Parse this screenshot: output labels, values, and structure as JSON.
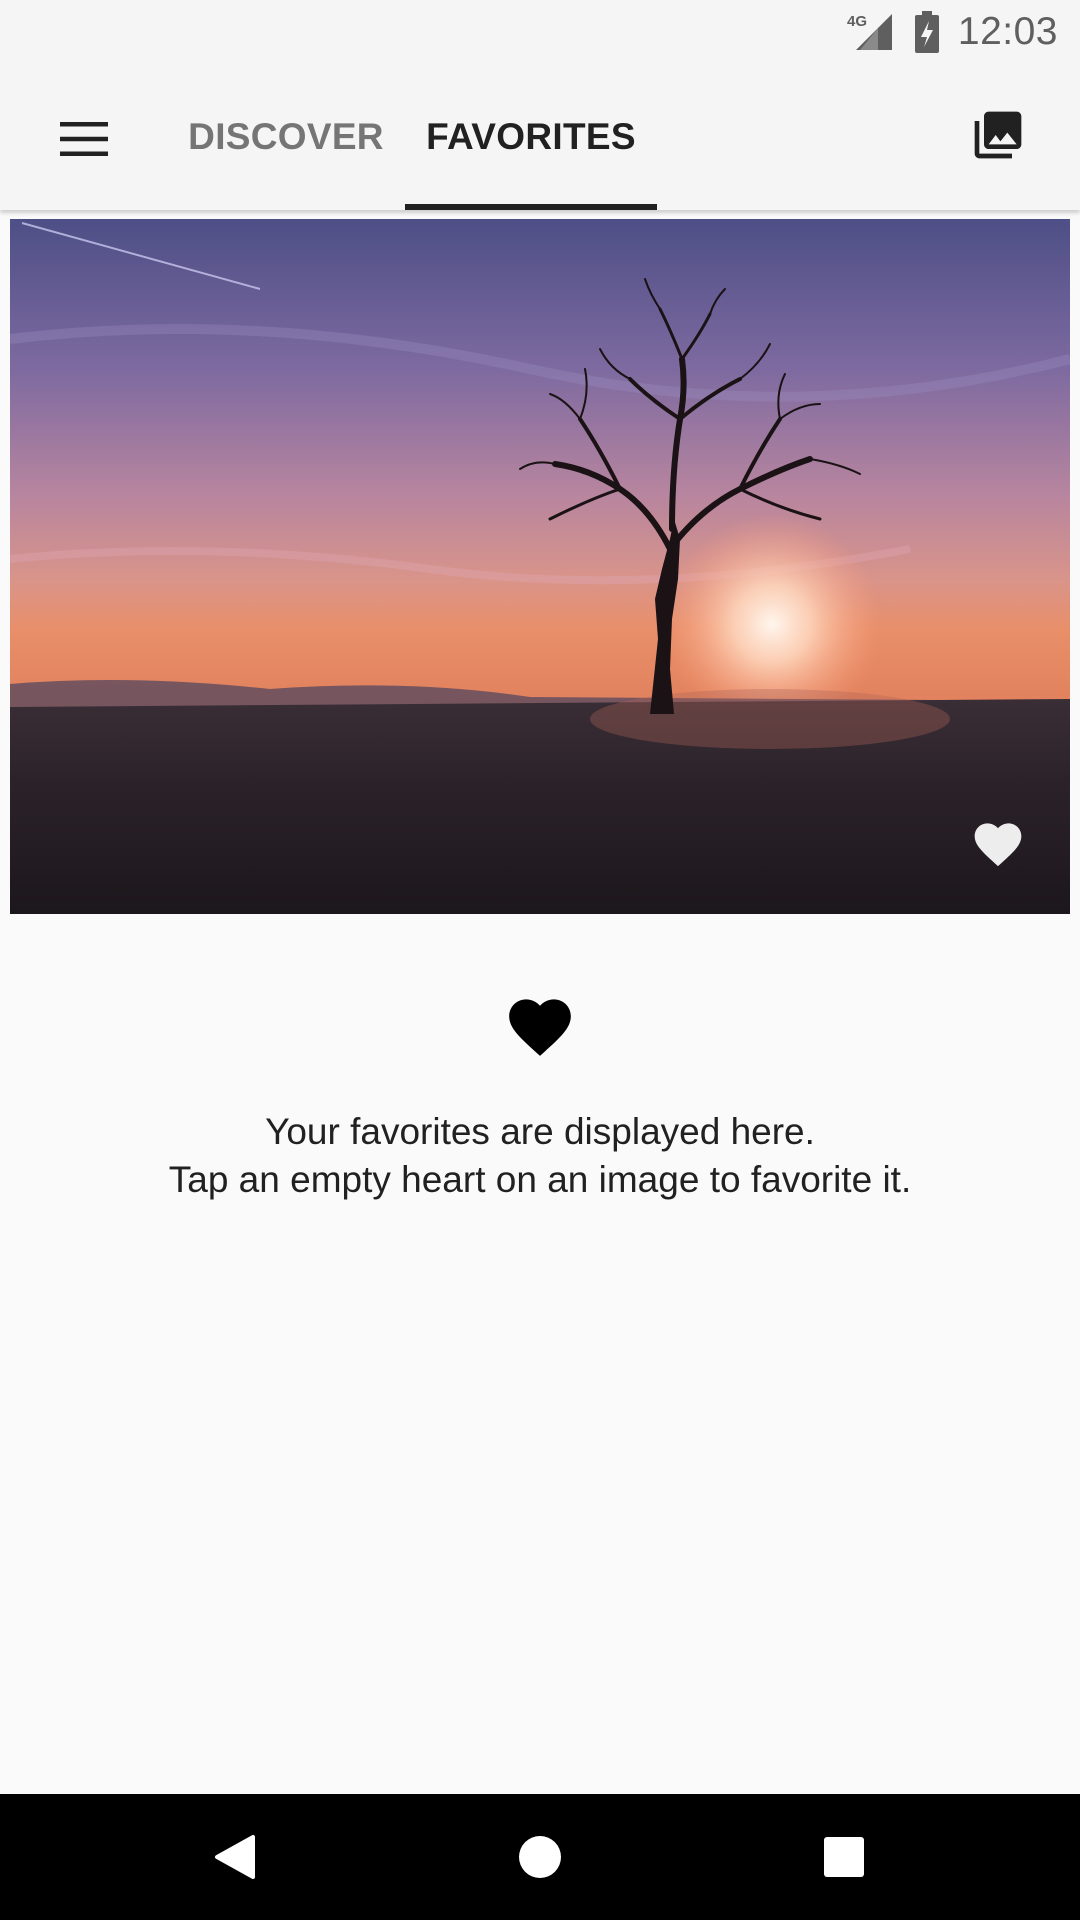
{
  "status_bar": {
    "network_label": "4G",
    "time": "12:03"
  },
  "tabs": [
    {
      "label": "DISCOVER",
      "selected": false
    },
    {
      "label": "FAVORITES",
      "selected": true
    }
  ],
  "icons": {
    "menu": "hamburger-menu-icon",
    "gallery": "photo-library-icon",
    "photo_favorite": "heart-icon",
    "empty_state": "heart-icon",
    "nav_back": "back-triangle-icon",
    "nav_home": "home-circle-icon",
    "nav_recents": "recents-square-icon"
  },
  "favorites": {
    "items": [
      {
        "subject": "tree-at-sunset-photo",
        "favorited": true
      }
    ]
  },
  "empty_state": {
    "line1": "Your favorites are displayed here.",
    "line2": "Tap an empty heart on an image to favorite it."
  },
  "colors": {
    "app_bar_bg": "#f5f5f5",
    "text_primary": "#212121",
    "text_secondary": "#757575",
    "nav_bar_bg": "#000000"
  }
}
